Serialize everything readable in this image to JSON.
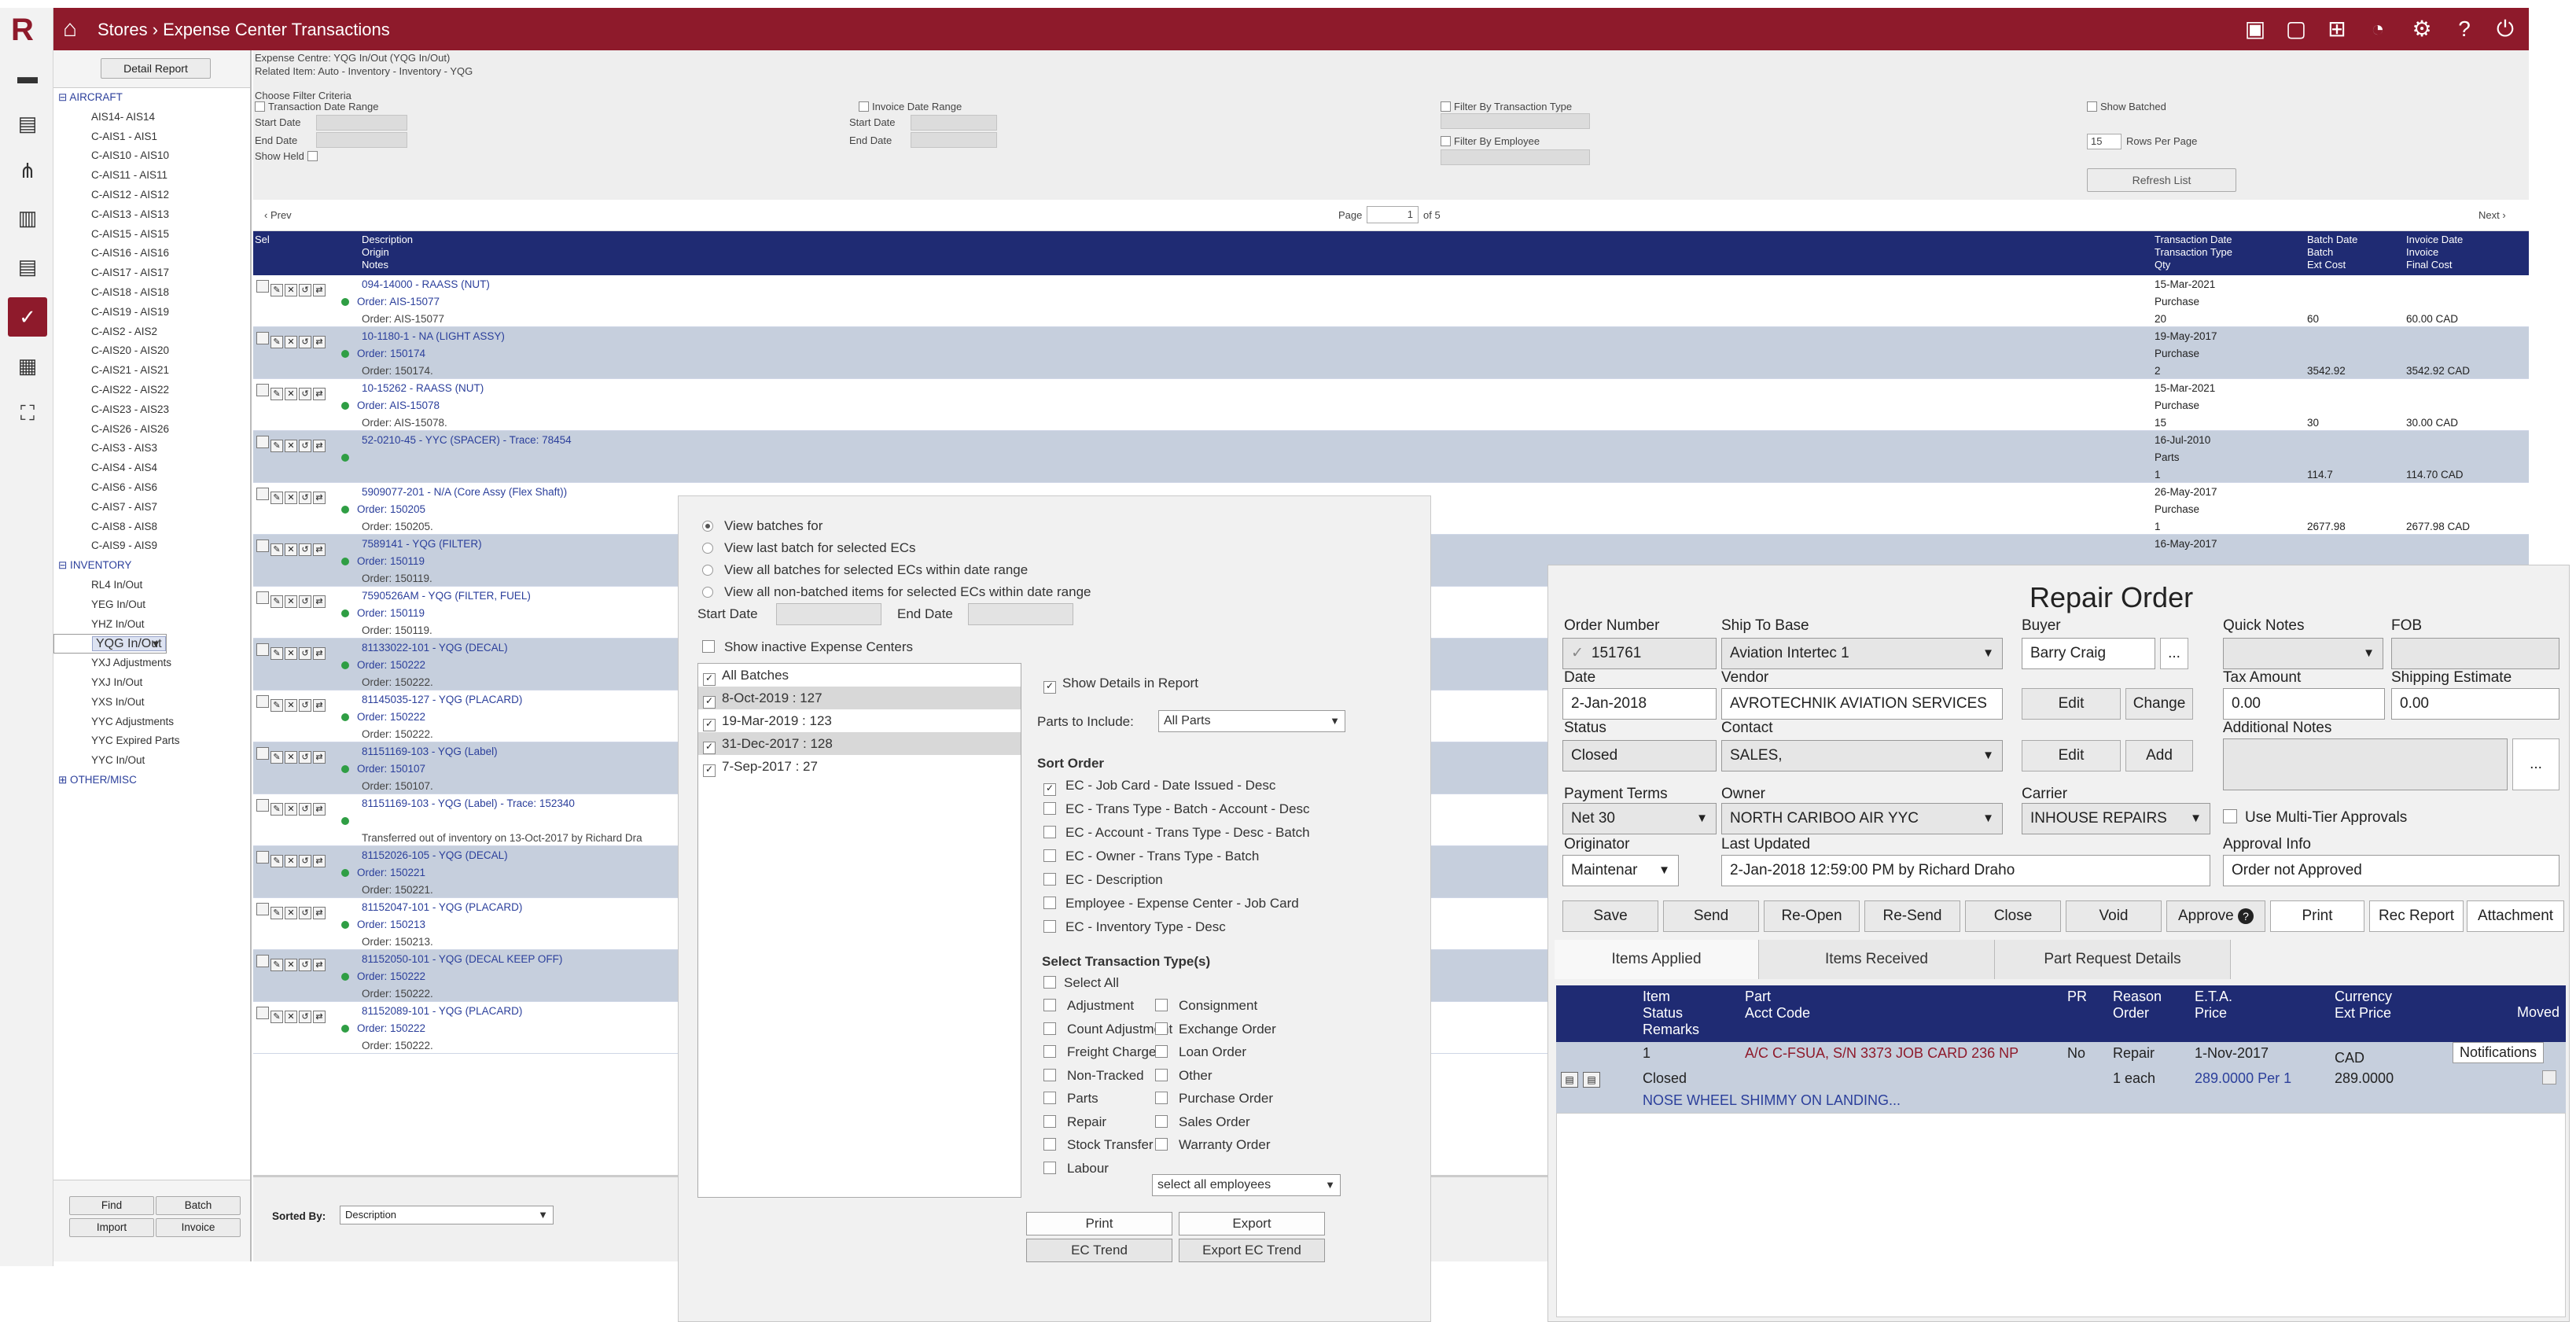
{
  "app": {
    "logo": "R",
    "breadcrumb": "Stores › Expense Center Transactions",
    "title_icons": [
      "id-card-icon",
      "comment-icon",
      "plus-square-icon",
      "pie-chart-icon",
      "gears-icon",
      "help-icon",
      "power-icon"
    ]
  },
  "rail": {
    "icons": [
      "folder-icon",
      "document-icon",
      "flow-icon",
      "report-icon",
      "document-lines-icon",
      "clipboard-check-icon",
      "calculator-icon",
      "expand-icon"
    ]
  },
  "tree": {
    "detail_report": "Detail Report",
    "items": [
      {
        "t": "group",
        "label": "⊟ AIRCRAFT"
      },
      {
        "t": "leaf",
        "label": "AIS14- AIS14"
      },
      {
        "t": "leaf",
        "label": "C-AIS1 - AIS1"
      },
      {
        "t": "leaf",
        "label": "C-AIS10 - AIS10"
      },
      {
        "t": "leaf",
        "label": "C-AIS11 - AIS11"
      },
      {
        "t": "leaf",
        "label": "C-AIS12 - AIS12"
      },
      {
        "t": "leaf",
        "label": "C-AIS13 - AIS13"
      },
      {
        "t": "leaf",
        "label": "C-AIS15 - AIS15"
      },
      {
        "t": "leaf",
        "label": "C-AIS16 - AIS16"
      },
      {
        "t": "leaf",
        "label": "C-AIS17 - AIS17"
      },
      {
        "t": "leaf",
        "label": "C-AIS18 - AIS18"
      },
      {
        "t": "leaf",
        "label": "C-AIS19 - AIS19"
      },
      {
        "t": "leaf",
        "label": "C-AIS2 - AIS2"
      },
      {
        "t": "leaf",
        "label": "C-AIS20 - AIS20"
      },
      {
        "t": "leaf",
        "label": "C-AIS21 - AIS21"
      },
      {
        "t": "leaf",
        "label": "C-AIS22 - AIS22"
      },
      {
        "t": "leaf",
        "label": "C-AIS23 - AIS23"
      },
      {
        "t": "leaf",
        "label": "C-AIS26 - AIS26"
      },
      {
        "t": "leaf",
        "label": "C-AIS3 - AIS3"
      },
      {
        "t": "leaf",
        "label": "C-AIS4 - AIS4"
      },
      {
        "t": "leaf",
        "label": "C-AIS6 - AIS6"
      },
      {
        "t": "leaf",
        "label": "C-AIS7 - AIS7"
      },
      {
        "t": "leaf",
        "label": "C-AIS8 - AIS8"
      },
      {
        "t": "leaf",
        "label": "C-AIS9 - AIS9"
      },
      {
        "t": "group",
        "label": "⊟ INVENTORY"
      },
      {
        "t": "leaf",
        "label": "RL4 In/Out"
      },
      {
        "t": "leaf",
        "label": "YEG In/Out"
      },
      {
        "t": "leaf",
        "label": "YHZ In/Out"
      },
      {
        "t": "leaf sel",
        "label": "YQG In/Out"
      },
      {
        "t": "leaf",
        "label": "YVR In/Out"
      },
      {
        "t": "leaf",
        "label": "YXJ Adjustments"
      },
      {
        "t": "leaf",
        "label": "YXJ In/Out"
      },
      {
        "t": "leaf",
        "label": "YXS In/Out"
      },
      {
        "t": "leaf",
        "label": "YYC Adjustments"
      },
      {
        "t": "leaf",
        "label": "YYC Expired Parts"
      },
      {
        "t": "leaf",
        "label": "YYC In/Out"
      },
      {
        "t": "group",
        "label": "⊞ OTHER/MISC"
      }
    ],
    "buttons": {
      "find": "Find",
      "batch": "Batch",
      "import": "Import",
      "invoice": "Invoice"
    }
  },
  "criteria": {
    "expense_centre": "Expense Centre: YQG In/Out (YQG In/Out)",
    "related_item": "Related Item:    Auto - Inventory - Inventory - YQG",
    "choose": "Choose Filter Criteria",
    "transaction_date_range": "Transaction Date Range",
    "start_date": "Start Date",
    "end_date": "End Date",
    "show_held": "Show Held",
    "invoice_date_range": "Invoice Date Range",
    "filter_type": "Filter By Transaction Type",
    "filter_employee": "Filter By Employee",
    "show_batched": "Show Batched",
    "rows_per_page_value": "15",
    "rows_per_page": "Rows Per Page",
    "refresh": "Refresh List"
  },
  "pager": {
    "prev": "‹ Prev",
    "page": "Page",
    "page_value": "1",
    "of": "of 5",
    "next": "Next ›"
  },
  "table": {
    "sel": "Sel",
    "desc_header": [
      "Description",
      "Origin",
      "Notes"
    ],
    "trans_header": [
      "Transaction Date",
      "Transaction Type",
      "Qty"
    ],
    "batch_header": [
      "Batch Date",
      "Batch",
      "Ext Cost"
    ],
    "invoice_header": [
      "Invoice Date",
      "Invoice",
      "Final Cost"
    ],
    "rows": [
      {
        "desc": "094-14000 - RAASS (NUT)",
        "order": "Order: AIS-15077",
        "note": "Order: AIS-15077",
        "date": "15-Mar-2021",
        "type": "Purchase",
        "qty": "20",
        "ext": "60",
        "final": "60.00 CAD"
      },
      {
        "desc": "10-1180-1 - NA (LIGHT ASSY)",
        "order": "Order: 150174",
        "note": "Order: 150174.",
        "date": "19-May-2017",
        "type": "Purchase",
        "qty": "2",
        "ext": "3542.92",
        "final": "3542.92 CAD"
      },
      {
        "desc": "10-15262 - RAASS (NUT)",
        "order": "Order: AIS-15078",
        "note": "Order: AIS-15078.",
        "date": "15-Mar-2021",
        "type": "Purchase",
        "qty": "15",
        "ext": "30",
        "final": "30.00 CAD"
      },
      {
        "desc": "52-0210-45 - YYC (SPACER) - Trace: 78454",
        "order": "",
        "note": "",
        "date": "16-Jul-2010",
        "type": "Parts",
        "qty": "1",
        "ext": "114.7",
        "final": "114.70 CAD"
      },
      {
        "desc": "5909077-201 - N/A (Core Assy (Flex Shaft))",
        "order": "Order: 150205",
        "note": "Order: 150205.",
        "date": "26-May-2017",
        "type": "Purchase",
        "qty": "1",
        "ext": "2677.98",
        "final": "2677.98 CAD"
      },
      {
        "desc": "7589141 - YQG (FILTER)",
        "order": "Order: 150119",
        "note": "Order: 150119.",
        "date": "16-May-2017",
        "type": "",
        "qty": "",
        "ext": "",
        "final": ""
      },
      {
        "desc": "7590526AM - YQG (FILTER, FUEL)",
        "order": "Order: 150119",
        "note": "Order: 150119.",
        "date": "",
        "type": "",
        "qty": "",
        "ext": "",
        "final": ""
      },
      {
        "desc": "81133022-101 - YQG (DECAL)",
        "order": "Order: 150222",
        "note": "Order: 150222.",
        "date": "",
        "type": "",
        "qty": "",
        "ext": "",
        "final": ""
      },
      {
        "desc": "81145035-127 - YQG (PLACARD)",
        "order": "Order: 150222",
        "note": "Order: 150222.",
        "date": "",
        "type": "",
        "qty": "",
        "ext": "",
        "final": ""
      },
      {
        "desc": "81151169-103 - YQG (Label)",
        "order": "Order: 150107",
        "note": "Order: 150107.",
        "date": "",
        "type": "",
        "qty": "",
        "ext": "",
        "final": ""
      },
      {
        "desc": "81151169-103 - YQG (Label) - Trace: 152340",
        "order": "",
        "note": "Transferred out of inventory on 13-Oct-2017 by Richard Dra",
        "date": "",
        "type": "",
        "qty": "",
        "ext": "",
        "final": ""
      },
      {
        "desc": "81152026-105 - YQG (DECAL)",
        "order": "Order: 150221",
        "note": "Order: 150221.",
        "date": "",
        "type": "",
        "qty": "",
        "ext": "",
        "final": ""
      },
      {
        "desc": "81152047-101 - YQG (PLACARD)",
        "order": "Order: 150213",
        "note": "Order: 150213.",
        "date": "",
        "type": "",
        "qty": "",
        "ext": "",
        "final": ""
      },
      {
        "desc": "81152050-101 - YQG (DECAL KEEP OFF)",
        "order": "Order: 150222",
        "note": "Order: 150222.",
        "date": "",
        "type": "",
        "qty": "",
        "ext": "",
        "final": ""
      },
      {
        "desc": "81152089-101 - YQG (PLACARD)",
        "order": "Order: 150222",
        "note": "Order: 150222.",
        "date": "",
        "type": "",
        "qty": "",
        "ext": "",
        "final": ""
      }
    ]
  },
  "sortbar": {
    "label": "Sorted By:",
    "value": "Description"
  },
  "report": {
    "radios": [
      "View batches for",
      "View last batch for selected ECs",
      "View all batches for selected ECs within date range",
      "View all non-batched items for selected ECs within date range"
    ],
    "start_date": "Start Date",
    "end_date": "End Date",
    "show_inactive": "Show inactive Expense Centers",
    "batches": [
      "All Batches",
      "8-Oct-2019 : 127",
      "19-Mar-2019 : 123",
      "31-Dec-2017 : 128",
      "7-Sep-2017 : 27"
    ],
    "show_details": "Show Details in Report",
    "parts_label": "Parts to Include:",
    "parts_value": "All Parts",
    "sort_order": "Sort Order",
    "sorts": [
      "EC - Job Card - Date Issued - Desc",
      "EC - Trans Type - Batch - Account - Desc",
      "EC - Account - Trans Type - Desc - Batch",
      "EC - Owner - Trans Type - Batch",
      "EC - Description",
      "Employee - Expense Center - Job Card",
      "EC - Inventory Type - Desc"
    ],
    "select_types": "Select Transaction Type(s)",
    "select_all": "Select All",
    "types_left": [
      "Adjustment",
      "Count Adjustment",
      "Freight Charge",
      "Non-Tracked",
      "Parts",
      "Repair",
      "Stock Transfer",
      "Labour"
    ],
    "types_right": [
      "Consignment",
      "Exchange Order",
      "Loan Order",
      "Other",
      "Purchase Order",
      "Sales Order",
      "Warranty Order"
    ],
    "employees": "select all employees",
    "print": "Print",
    "export": "Export",
    "ec_trend": "EC Trend",
    "export_ec_trend": "Export EC Trend"
  },
  "repair": {
    "title": "Repair Order",
    "order_number_label": "Order Number",
    "order_number": "151761",
    "ship_to_label": "Ship To Base",
    "ship_to": "Aviation Intertec 1",
    "buyer_label": "Buyer",
    "buyer": "Barry Craig",
    "ellipsis": "...",
    "quick_notes_label": "Quick Notes",
    "fob_label": "FOB",
    "date_label": "Date",
    "date": "2-Jan-2018",
    "vendor_label": "Vendor",
    "vendor": "AVROTECHNIK AVIATION SERVICES",
    "edit": "Edit",
    "change": "Change",
    "tax_label": "Tax Amount",
    "tax": "0.00",
    "shipping_label": "Shipping Estimate",
    "shipping": "0.00",
    "status_label": "Status",
    "status": "Closed",
    "contact_label": "Contact",
    "contact": "SALES,",
    "add": "Add",
    "notes_label": "Additional Notes",
    "terms_label": "Payment Terms",
    "terms": "Net 30",
    "owner_label": "Owner",
    "owner": "NORTH CARIBOO AIR YYC",
    "carrier_label": "Carrier",
    "carrier": "INHOUSE REPAIRS",
    "multi_tier": "Use Multi-Tier Approvals",
    "originator_label": "Originator",
    "originator": "Maintenar",
    "updated_label": "Last Updated",
    "updated": "2-Jan-2018 12:59:00 PM by Richard Draho",
    "approval_label": "Approval Info",
    "approval": "Order not Approved",
    "buttons": {
      "save": "Save",
      "send": "Send",
      "reopen": "Re-Open",
      "resend": "Re-Send",
      "close": "Close",
      "void": "Void",
      "approve": "Approve",
      "print": "Print",
      "rec_report": "Rec Report",
      "attachment": "Attachment"
    },
    "tabs": [
      "Items Applied",
      "Items Received",
      "Part Request Details"
    ],
    "items_head": {
      "item": [
        "Item",
        "Status",
        "Remarks"
      ],
      "part": [
        "Part",
        "Acct Code"
      ],
      "pr": "PR",
      "reason": [
        "Reason",
        "Order"
      ],
      "eta": [
        "E.T.A.",
        "Price"
      ],
      "currency": [
        "Currency",
        "Ext Price"
      ],
      "moved": "Moved"
    },
    "item": {
      "num": "1",
      "part": "A/C C-FSUA, S/N 3373 JOB CARD 236 NP",
      "pr": "No",
      "reason": "Repair",
      "eta": "1-Nov-2017",
      "currency": "CAD",
      "notifications": "Notifications",
      "status": "Closed",
      "order": "1 each",
      "price": "289.0000 Per 1",
      "ext": "289.0000",
      "remarks": "NOSE WHEEL SHIMMY ON LANDING..."
    }
  }
}
